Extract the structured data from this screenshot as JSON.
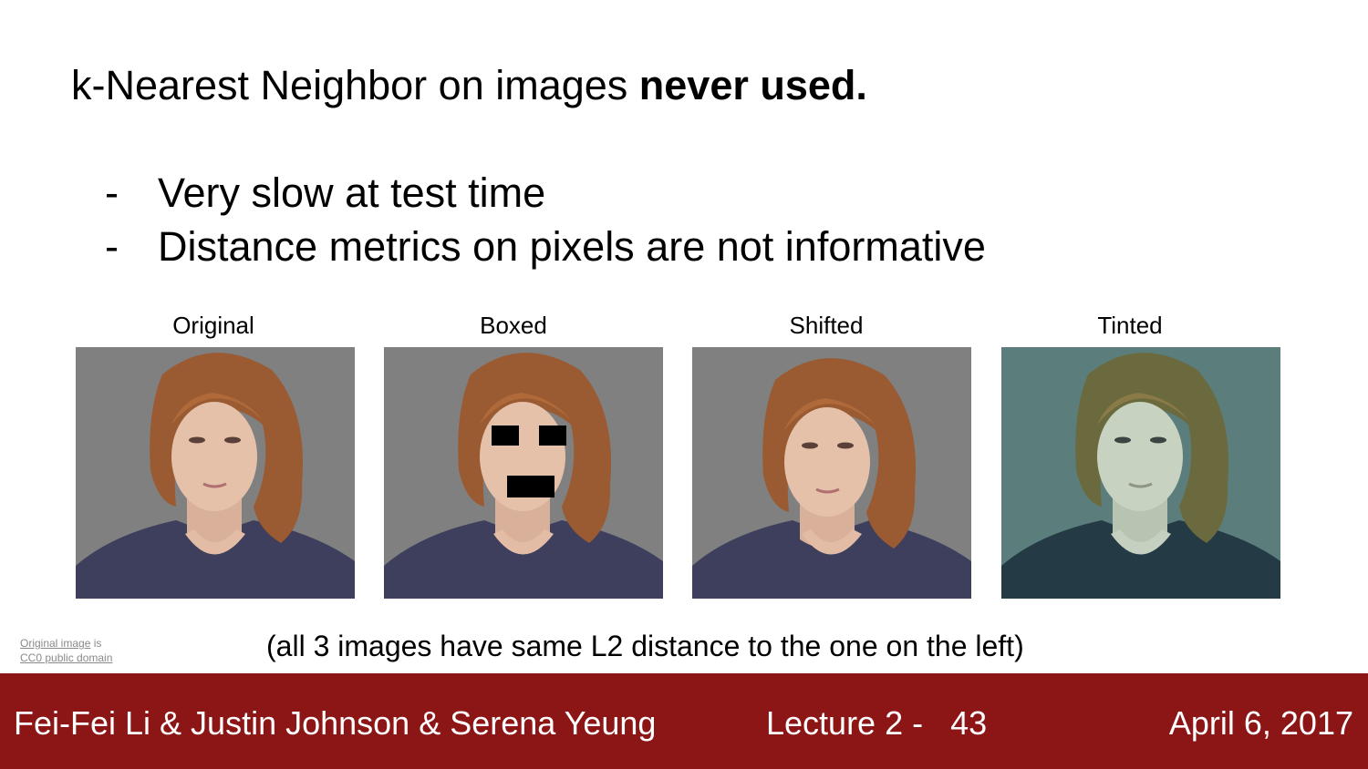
{
  "slide": {
    "title_plain": "k-Nearest Neighbor on images ",
    "title_bold": "never used.",
    "bullets": [
      {
        "marker": "-",
        "text": "Very slow at test time"
      },
      {
        "marker": "-",
        "text": "Distance metrics on pixels are not informative"
      }
    ],
    "images": [
      {
        "label": "Original",
        "background": "#808080",
        "tint": "none"
      },
      {
        "label": "Boxed",
        "background": "#808080",
        "tint": "none"
      },
      {
        "label": "Shifted",
        "background": "#808080",
        "tint": "none"
      },
      {
        "label": "Tinted",
        "background": "#5b7e7c",
        "tint": "teal"
      }
    ],
    "caption": "(all 3 images have same L2 distance to the one on the left)",
    "credit": {
      "link1": "Original image",
      "text1": " is",
      "link2": "CC0 public domain"
    }
  },
  "footer": {
    "authors": "Fei-Fei Li & Justin Johnson & Serena Yeung",
    "lecture": "Lecture 2 -   43",
    "date": "April 6, 2017",
    "color": "#8c1515"
  }
}
